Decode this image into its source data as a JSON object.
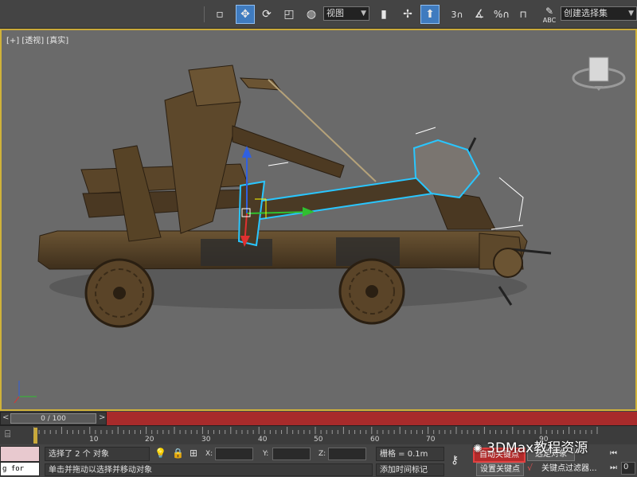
{
  "toolbar": {
    "view_select": "视图",
    "selection_set_select": "创建选择集",
    "snap_3d": "3",
    "percent_snap": "%",
    "spinner_snap": "n",
    "abc_label": "ABC"
  },
  "viewport": {
    "label": "[+] [透视] [真实]"
  },
  "timeslider": {
    "prev": "<",
    "frame": "0 / 100",
    "next": ">"
  },
  "trackbar": {
    "ticks": [
      "10",
      "20",
      "30",
      "40",
      "50",
      "60",
      "70",
      "90"
    ]
  },
  "statusbar": {
    "script_listener": "g for AIK",
    "selection_status": "选择了 2 个 对象",
    "prompt": "单击并拖动以选择并移动对象",
    "x_label": "X:",
    "y_label": "Y:",
    "z_label": "Z:",
    "grid": "栅格 = 0.1m",
    "add_time_tag": "添加时间标记",
    "auto_key": "自动关键点",
    "selected_obj": "选定对象",
    "set_key": "设置关键点",
    "key_filters": "关键点过滤器...",
    "frame_value": "0"
  },
  "watermark": "3DMax教程资源",
  "colors": {
    "viewport_bg": "#6a6a6a",
    "active_border": "#d0b23a",
    "timeslider_bg": "#a82b2b",
    "selection_outline": "#29c6ff",
    "gizmo_x": "#e03030",
    "gizmo_y": "#30c030",
    "gizmo_z": "#3060e0"
  }
}
